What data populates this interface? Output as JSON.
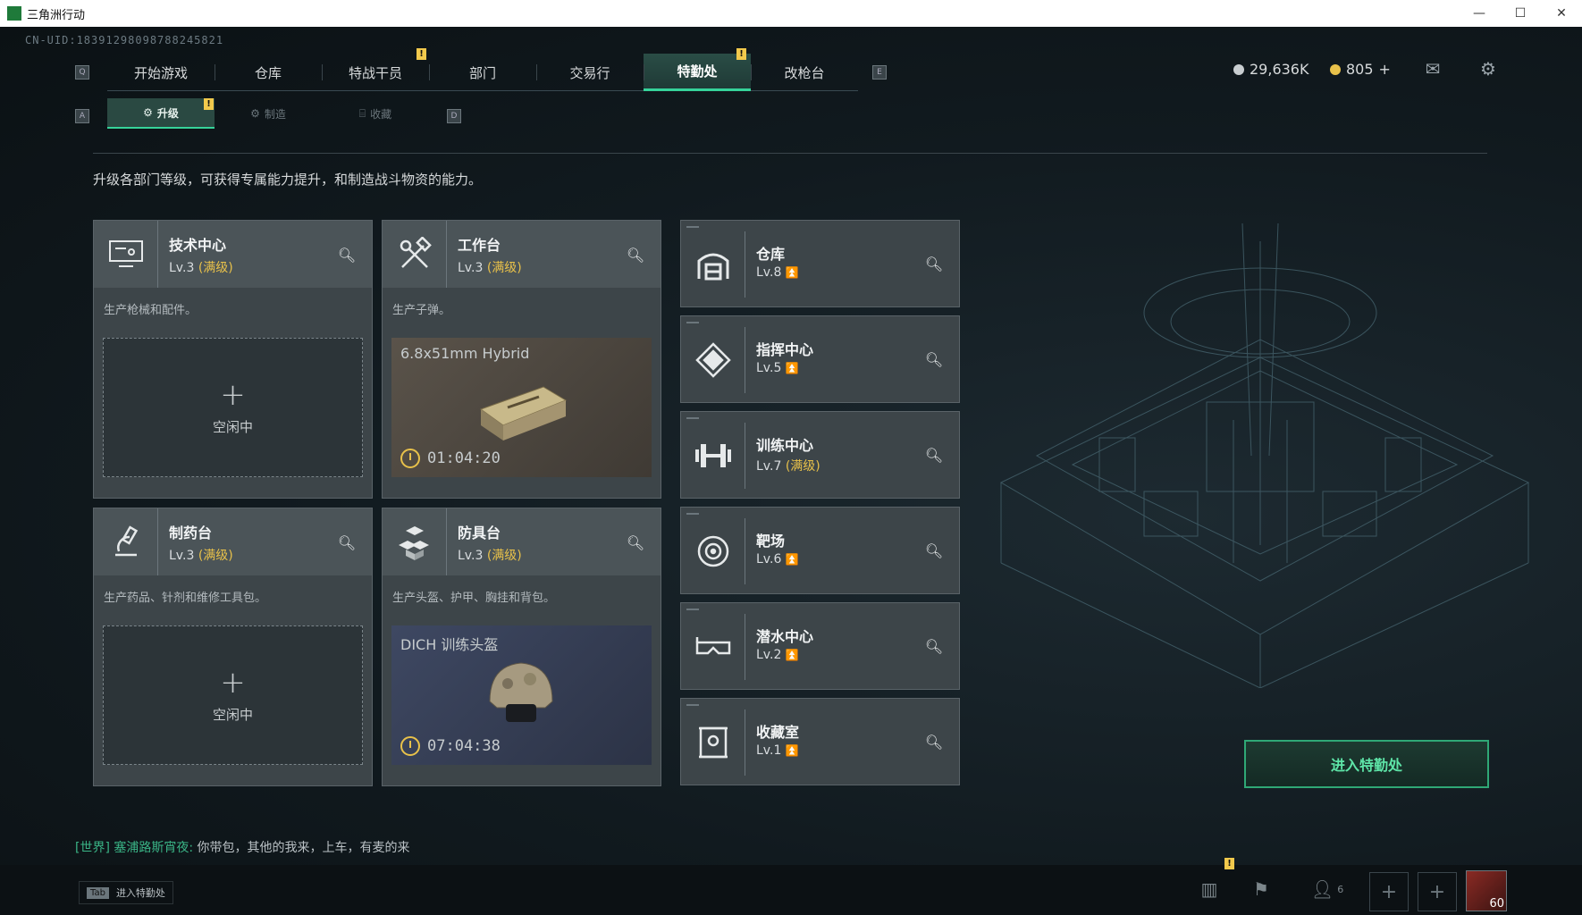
{
  "window": {
    "title": "三角洲行动",
    "min": "—",
    "max": "☐",
    "close": "✕"
  },
  "uid": "CN-UID:18391298098788245821",
  "nav_keys": {
    "left": "Q",
    "right": "E",
    "sub_left": "A",
    "sub_right": "D"
  },
  "top_tabs": [
    {
      "label": "开始游戏"
    },
    {
      "label": "仓库"
    },
    {
      "label": "特战干员"
    },
    {
      "label": "部门"
    },
    {
      "label": "交易行"
    },
    {
      "label": "特勤处",
      "active": true
    },
    {
      "label": "改枪台"
    }
  ],
  "badges": {
    "mark": "!"
  },
  "currency": {
    "silver": "29,636K",
    "gold": "805",
    "gold_plus": "+"
  },
  "sub_tabs": [
    {
      "label": "升级",
      "active": true
    },
    {
      "label": "制造"
    },
    {
      "label": "收藏"
    }
  ],
  "description": "升级各部门等级，可获得专属能力提升，和制造战斗物资的能力。",
  "cards": [
    {
      "name": "技术中心",
      "level": "Lv.3",
      "max_tag": "(满级)",
      "desc": "生产枪械和配件。",
      "state": "idle",
      "idle_text": "空闲中",
      "icon": "monitor-icon"
    },
    {
      "name": "工作台",
      "level": "Lv.3",
      "max_tag": "(满级)",
      "desc": "生产子弹。",
      "state": "busy",
      "item": "6.8x51mm Hybrid",
      "timer": "01:04:20",
      "icon": "hammer-wrench-icon"
    },
    {
      "name": "制药台",
      "level": "Lv.3",
      "max_tag": "(满级)",
      "desc": "生产药品、针剂和维修工具包。",
      "state": "idle",
      "idle_text": "空闲中",
      "icon": "microscope-icon"
    },
    {
      "name": "防具台",
      "level": "Lv.3",
      "max_tag": "(满级)",
      "desc": "生产头盔、护甲、胸挂和背包。",
      "state": "busy",
      "item": "DICH 训练头盔",
      "timer": "07:04:38",
      "icon": "blocks-icon"
    }
  ],
  "facilities": [
    {
      "name": "仓库",
      "level": "Lv.8",
      "tag": "",
      "icon": "warehouse-icon"
    },
    {
      "name": "指挥中心",
      "level": "Lv.5",
      "tag": "",
      "icon": "command-icon"
    },
    {
      "name": "训练中心",
      "level": "Lv.7",
      "tag": "(满级)",
      "icon": "dumbbell-icon"
    },
    {
      "name": "靶场",
      "level": "Lv.6",
      "tag": "",
      "icon": "target-icon"
    },
    {
      "name": "潜水中心",
      "level": "Lv.2",
      "tag": "",
      "icon": "dive-mask-icon"
    },
    {
      "name": "收藏室",
      "level": "Lv.1",
      "tag": "",
      "icon": "vault-icon"
    }
  ],
  "enter_button": "进入特勤处",
  "chat": {
    "channel": "[世界] 塞浦路斯宵夜:",
    "message": "你带包，其他的我来，上车，有麦的来"
  },
  "footer": {
    "tab_key": "Tab",
    "tab_label": "进入特勤处",
    "friends_count": "6",
    "player_level": "60"
  },
  "colors": {
    "accent": "#36d39a",
    "gold": "#e8c14a",
    "panel": "#3d4549"
  }
}
